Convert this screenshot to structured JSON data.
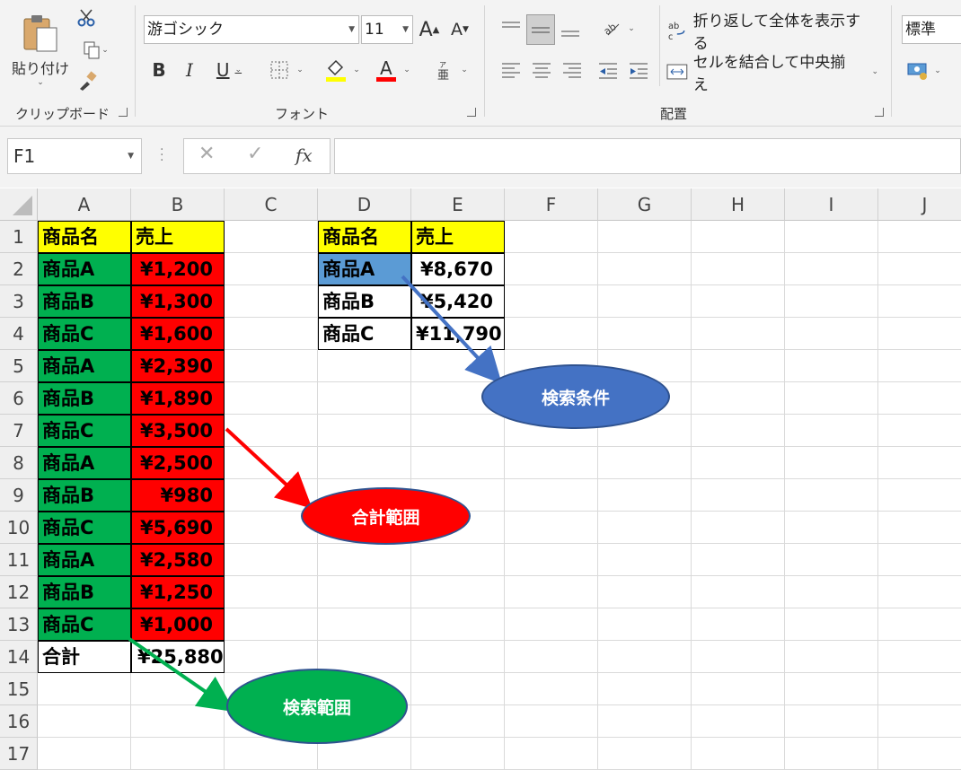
{
  "ribbon": {
    "clipboard": {
      "label": "クリップボード",
      "paste_label": "貼り付け"
    },
    "font": {
      "label": "フォント",
      "name": "游ゴシック",
      "size": "11",
      "bold": "B",
      "italic": "I",
      "underline": "U"
    },
    "alignment": {
      "label": "配置",
      "wrap_label": "折り返して全体を表示する",
      "merge_label": "セルを結合して中央揃え"
    },
    "number": {
      "format": "標準"
    }
  },
  "formula_bar": {
    "name_box": "F1",
    "fx": "fx",
    "formula": ""
  },
  "columns": [
    "A",
    "B",
    "C",
    "D",
    "E",
    "F",
    "G",
    "H",
    "I",
    "J"
  ],
  "rows": [
    "1",
    "2",
    "3",
    "4",
    "5",
    "6",
    "7",
    "8",
    "9",
    "10",
    "11",
    "12",
    "13",
    "14",
    "15",
    "16",
    "17"
  ],
  "table1": {
    "header_name": "商品名",
    "header_sales": "売上",
    "rows": [
      {
        "name": "商品A",
        "sales": "¥1,200"
      },
      {
        "name": "商品B",
        "sales": "¥1,300"
      },
      {
        "name": "商品C",
        "sales": "¥1,600"
      },
      {
        "name": "商品A",
        "sales": "¥2,390"
      },
      {
        "name": "商品B",
        "sales": "¥1,890"
      },
      {
        "name": "商品C",
        "sales": "¥3,500"
      },
      {
        "name": "商品A",
        "sales": "¥2,500"
      },
      {
        "name": "商品B",
        "sales": "¥980"
      },
      {
        "name": "商品C",
        "sales": "¥5,690"
      },
      {
        "name": "商品A",
        "sales": "¥2,580"
      },
      {
        "name": "商品B",
        "sales": "¥1,250"
      },
      {
        "name": "商品C",
        "sales": "¥1,000"
      }
    ],
    "total_label": "合計",
    "total_value": "¥25,880"
  },
  "table2": {
    "header_name": "商品名",
    "header_sales": "売上",
    "rows": [
      {
        "name": "商品A",
        "sales": "¥8,670"
      },
      {
        "name": "商品B",
        "sales": "¥5,420"
      },
      {
        "name": "商品C",
        "sales": "¥11,790"
      }
    ]
  },
  "callouts": {
    "criteria": "検索条件",
    "sum_range": "合計範囲",
    "search_range": "検索範囲"
  },
  "colors": {
    "header_yellow": "#ffff00",
    "green": "#00b050",
    "red": "#ff0000",
    "selected_blue": "#5b9bd5",
    "oval_blue": "#4472c4"
  }
}
